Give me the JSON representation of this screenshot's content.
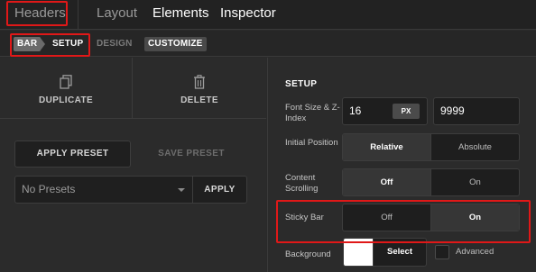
{
  "top_nav": {
    "tabs": [
      {
        "label": "Headers",
        "state": "highlighted"
      },
      {
        "label": "Layout",
        "state": "inactive"
      },
      {
        "label": "Elements",
        "state": "inactive"
      },
      {
        "label": "Inspector",
        "state": "active"
      }
    ]
  },
  "breadcrumb": {
    "bar": "BAR",
    "setup": "SETUP",
    "design": "DESIGN",
    "customize": "CUSTOMIZE"
  },
  "left_panel": {
    "duplicate_label": "DUPLICATE",
    "delete_label": "DELETE",
    "apply_preset_label": "APPLY PRESET",
    "save_preset_label": "SAVE PRESET",
    "preset_select_value": "No Presets",
    "apply_label": "APPLY"
  },
  "right_panel": {
    "heading": "SETUP",
    "font_size_label": "Font Size & Z-Index",
    "font_size_value": "16",
    "font_size_unit": "PX",
    "z_index_value": "9999",
    "initial_position": {
      "label": "Initial Position",
      "options": [
        "Relative",
        "Absolute"
      ],
      "selected": "Relative"
    },
    "content_scrolling": {
      "label": "Content Scrolling",
      "options": [
        "Off",
        "On"
      ],
      "selected": "Off"
    },
    "sticky_bar": {
      "label": "Sticky Bar",
      "options": [
        "Off",
        "On"
      ],
      "selected": "On"
    },
    "background": {
      "label": "Background",
      "color": "#ffffff",
      "select_label": "Select",
      "advanced_label": "Advanced",
      "advanced_checked": false
    }
  },
  "colors": {
    "highlight": "#e01818",
    "panel_bg": "#2b2b2b",
    "input_bg": "#1e1e1e"
  }
}
